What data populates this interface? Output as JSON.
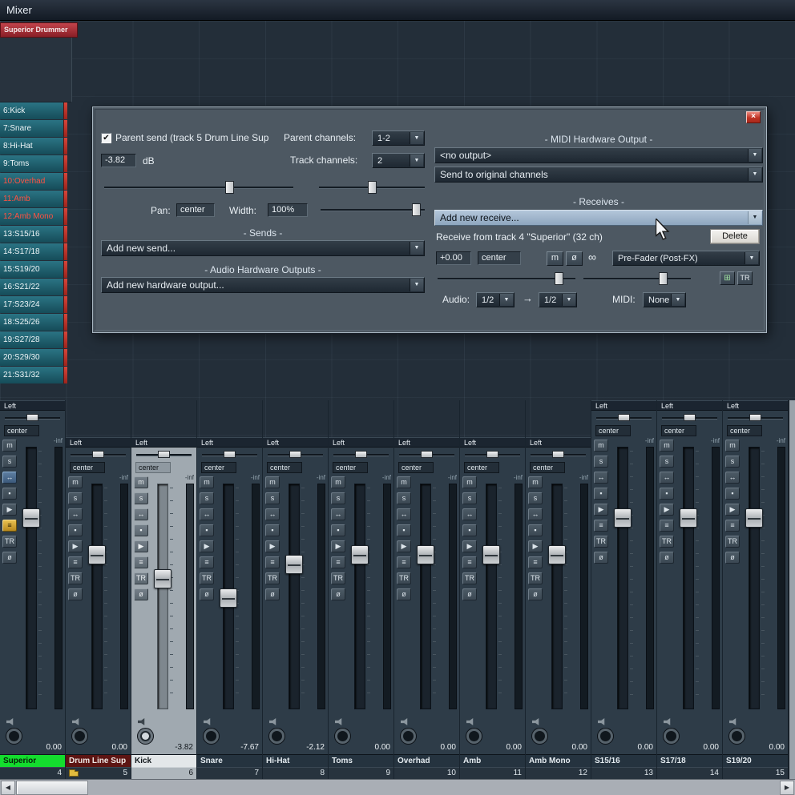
{
  "window": {
    "title": "Mixer"
  },
  "track_panel": {
    "header": "Superior Drummer",
    "items": [
      {
        "label": "6:Kick",
        "cls": ""
      },
      {
        "label": "7:Snare",
        "cls": ""
      },
      {
        "label": "8:Hi-Hat",
        "cls": ""
      },
      {
        "label": "9:Toms",
        "cls": ""
      },
      {
        "label": "10:Overhad",
        "cls": "armed"
      },
      {
        "label": "11:Amb",
        "cls": "armed"
      },
      {
        "label": "12:Amb Mono",
        "cls": "armed"
      },
      {
        "label": "13:S15/16",
        "cls": ""
      },
      {
        "label": "14:S17/18",
        "cls": ""
      },
      {
        "label": "15:S19/20",
        "cls": ""
      },
      {
        "label": "16:S21/22",
        "cls": ""
      },
      {
        "label": "17:S23/24",
        "cls": ""
      },
      {
        "label": "18:S25/26",
        "cls": ""
      },
      {
        "label": "19:S27/28",
        "cls": ""
      },
      {
        "label": "20:S29/30",
        "cls": ""
      },
      {
        "label": "21:S31/32",
        "cls": ""
      }
    ]
  },
  "common": {
    "out": "Left",
    "pan": "center",
    "peak": "-inf"
  },
  "strip_buttons": [
    "m",
    "s",
    "↔",
    "▪",
    "▶",
    "≡",
    "TR",
    "ø"
  ],
  "strips": [
    {
      "name": "Superior",
      "number": "4",
      "db": "0.00",
      "cls": "tall sup",
      "style": "--ft:26%;--nbg:#14dd2e;--nfg:#062408"
    },
    {
      "name": "Drum Line Sup",
      "number": "5",
      "db": "0.00",
      "cls": "",
      "style": "--ft:30%;--nbg:#5d1513;--nfg:#efe9e6",
      "folder": true
    },
    {
      "name": "Kick",
      "number": "6",
      "db": "-3.82",
      "cls": "sel",
      "style": "--ft:40%;--nbg:#e3e7e9;--nfg:#141a1e",
      "dot": true
    },
    {
      "name": "Snare",
      "number": "7",
      "db": "-7.67",
      "cls": "",
      "style": "--ft:48%"
    },
    {
      "name": "Hi-Hat",
      "number": "8",
      "db": "-2.12",
      "cls": "",
      "style": "--ft:34%"
    },
    {
      "name": "Toms",
      "number": "9",
      "db": "0.00",
      "cls": "",
      "style": "--ft:30%"
    },
    {
      "name": "Overhad",
      "number": "10",
      "db": "0.00",
      "cls": "",
      "style": "--ft:30%"
    },
    {
      "name": "Amb",
      "number": "11",
      "db": "0.00",
      "cls": "",
      "style": "--ft:30%"
    },
    {
      "name": "Amb Mono",
      "number": "12",
      "db": "0.00",
      "cls": "",
      "style": "--ft:30%"
    },
    {
      "name": "S15/16",
      "number": "13",
      "db": "0.00",
      "cls": "tall",
      "style": "--ft:26%"
    },
    {
      "name": "S17/18",
      "number": "14",
      "db": "0.00",
      "cls": "tall",
      "style": "--ft:26%"
    },
    {
      "name": "S19/20",
      "number": "15",
      "db": "0.00",
      "cls": "tall",
      "style": "--ft:26%"
    }
  ],
  "dialog": {
    "parent_send": {
      "label": "Parent send (track 5 Drum Line Sup"
    },
    "volume": {
      "value": "-3.82",
      "unit": "dB"
    },
    "parent_channels": {
      "label": "Parent channels:",
      "value": "1-2"
    },
    "track_channels": {
      "label": "Track channels:",
      "value": "2"
    },
    "pan": {
      "label": "Pan:",
      "value": "center"
    },
    "width": {
      "label": "Width:",
      "value": "100%"
    },
    "sends": {
      "header": "- Sends -",
      "add": "Add new send..."
    },
    "hw_outputs": {
      "header": "- Audio Hardware Outputs -",
      "add": "Add new hardware output..."
    },
    "midi_output": {
      "header": "- MIDI Hardware Output -",
      "device": "<no output>",
      "channels": "Send to original channels"
    },
    "receives": {
      "header": "- Receives -",
      "add": "Add new receive...",
      "info": "Receive from track 4 \"Superior\" (32 ch)",
      "delete": "Delete",
      "volume": "+0.00",
      "pan": "center",
      "mute": "m",
      "phase": "ø",
      "mode": "Pre-Fader (Post-FX)",
      "audio_label": "Audio:",
      "audio_from": "1/2",
      "audio_to": "1/2",
      "midi_label": "MIDI:",
      "midi_value": "None"
    }
  },
  "icons": {
    "combo_arrow": "▼",
    "check": "✔",
    "close": "×",
    "mono": "∞",
    "routing_matrix": "⊞",
    "trim": "TR",
    "audio_arrow": "→",
    "scroll_left": "◀",
    "scroll_right": "▶"
  }
}
